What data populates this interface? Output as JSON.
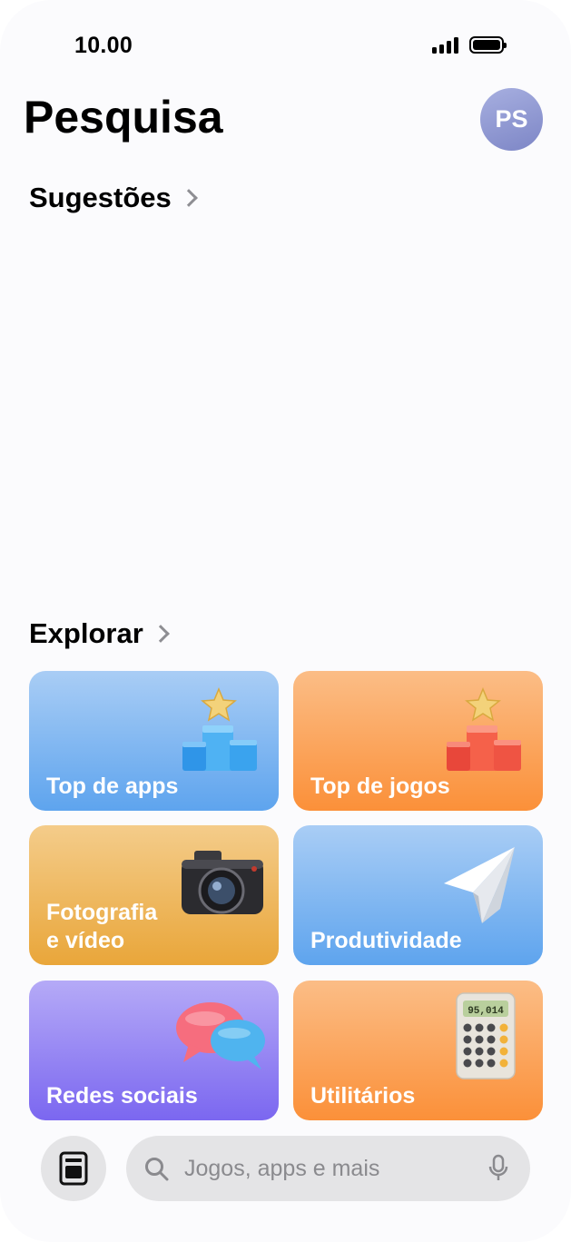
{
  "status_bar": {
    "time": "10.00",
    "icons": [
      "cellular-signal-icon",
      "battery-icon"
    ]
  },
  "header": {
    "title": "Pesquisa",
    "avatar_initials": "PS"
  },
  "sections": {
    "suggestions": {
      "label": "Sugestões"
    },
    "explore": {
      "label": "Explorar"
    }
  },
  "categories": [
    {
      "label": "Top de apps",
      "icon": "podium-star-icon",
      "color": "#5ea4ee"
    },
    {
      "label": "Top de jogos",
      "icon": "podium-star-icon",
      "color": "#fb9039"
    },
    {
      "label": "Fotografia\ne vídeo",
      "icon": "camera-icon",
      "color": "#e9a63a"
    },
    {
      "label": "Produtividade",
      "icon": "paper-plane-icon",
      "color": "#5ea4ee"
    },
    {
      "label": "Redes sociais",
      "icon": "chat-bubbles-icon",
      "color": "#7b67f0"
    },
    {
      "label": "Utilitários",
      "icon": "calculator-icon",
      "color": "#fb9039",
      "calculator_display": "95,014"
    }
  ],
  "bottom_bar": {
    "library_icon": "library-icon",
    "search_placeholder": "Jogos, apps e mais",
    "mic_icon": "microphone-icon"
  }
}
